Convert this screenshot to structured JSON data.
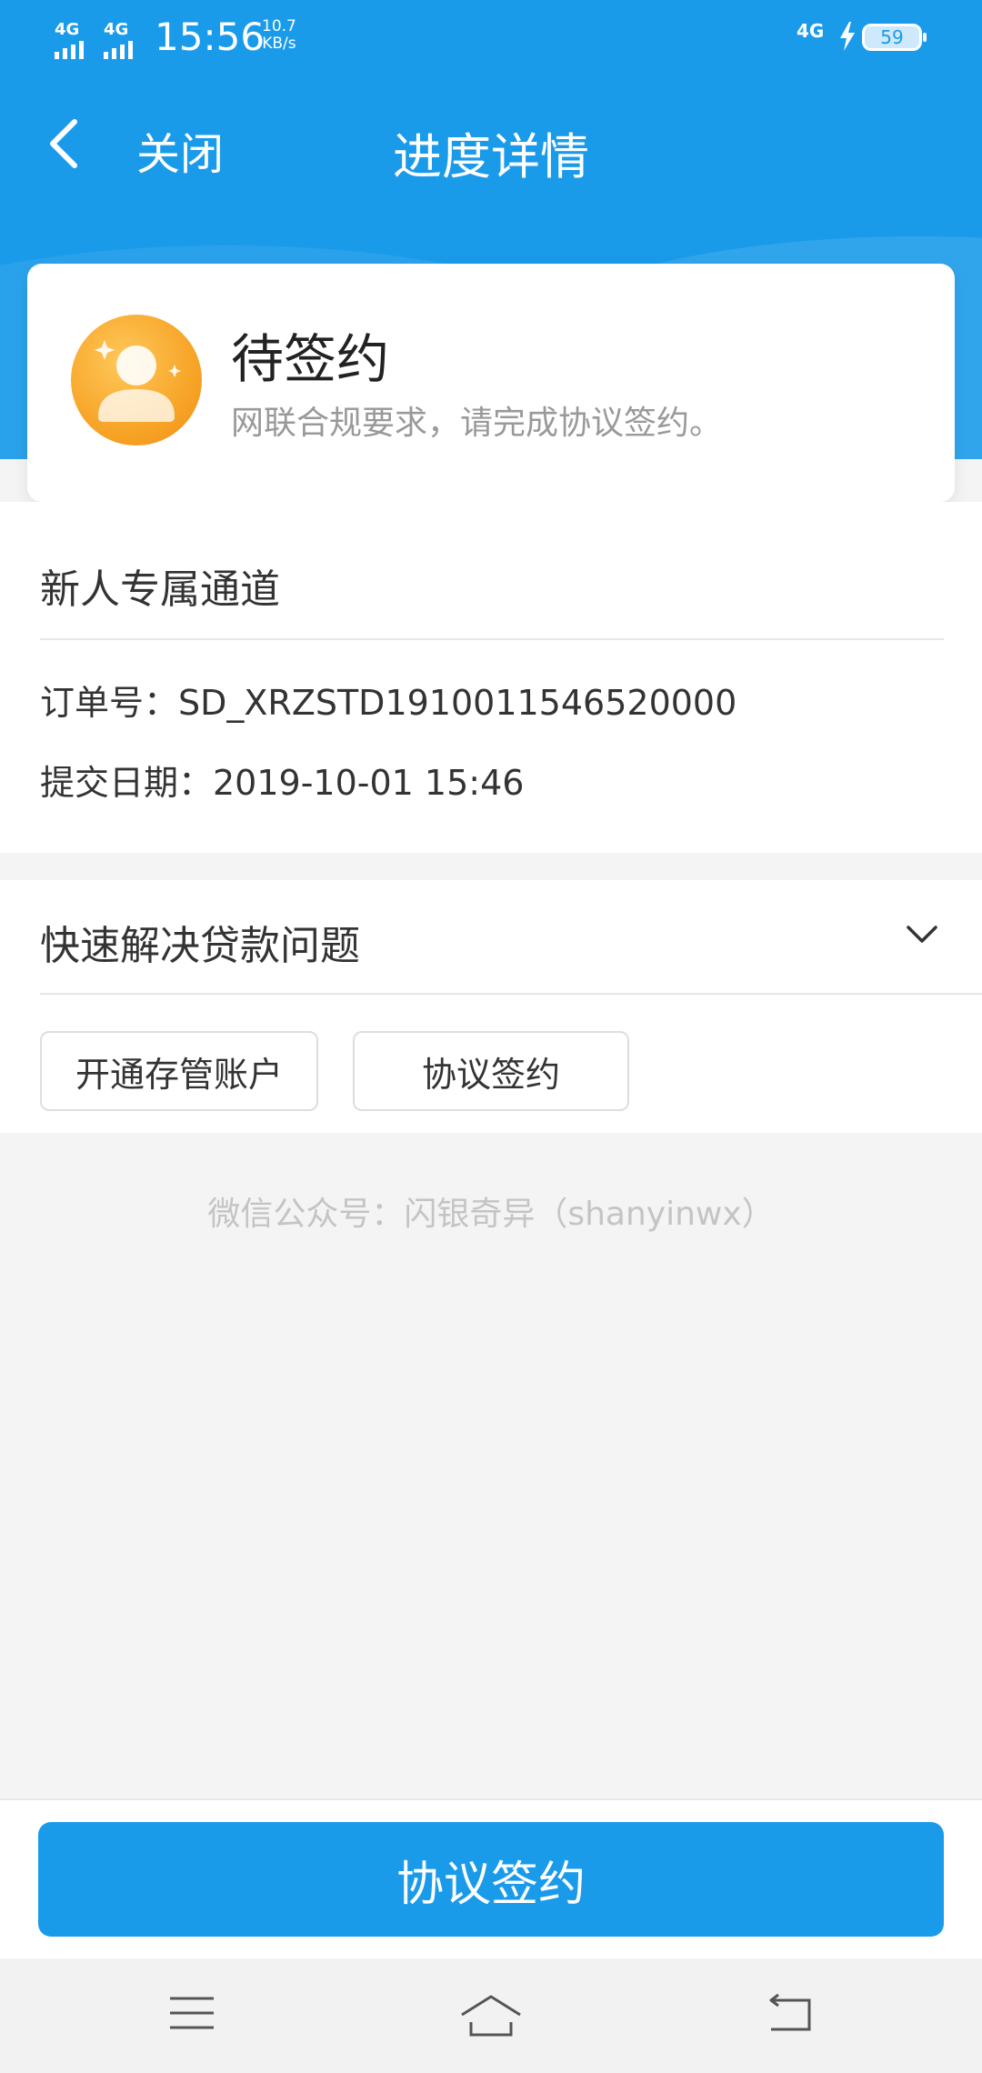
{
  "status_bar": {
    "network_1": "4G",
    "network_2": "4G",
    "time": "15:56",
    "speed_value": "10.7",
    "speed_unit": "KB/s",
    "network_right": "4G",
    "battery": "59"
  },
  "nav": {
    "close_label": "关闭",
    "title": "进度详情"
  },
  "status_card": {
    "title": "待签约",
    "description": "网联合规要求，请完成协议签约。"
  },
  "order": {
    "channel": "新人专属通道",
    "order_no": "订单号：SD_XRZSTD1910011546520000",
    "submit_date": "提交日期：2019-10-01 15:46"
  },
  "quick": {
    "title": "快速解决贷款问题",
    "buttons": [
      "开通存管账户",
      "协议签约"
    ]
  },
  "footer_note": "微信公众号：闪银奇异（shanyinwx）",
  "primary_button": "协议签约",
  "colors": {
    "brand": "#1a9bea",
    "avatar": "#f7a528"
  }
}
